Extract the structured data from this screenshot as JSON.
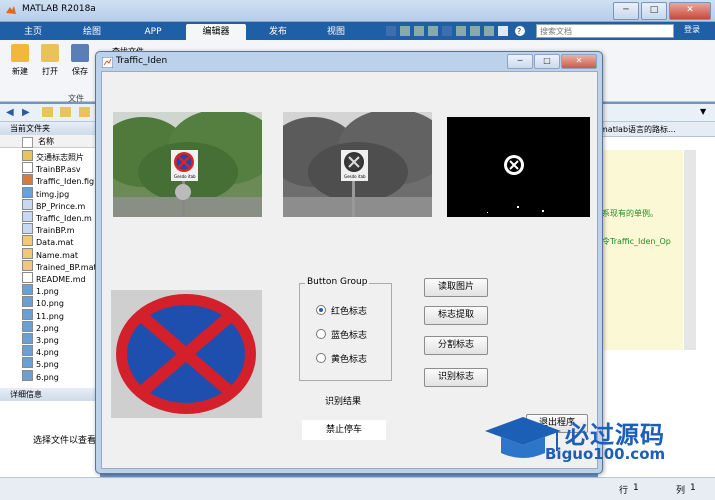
{
  "app": {
    "title": "MATLAB R2018a"
  },
  "tabs": [
    {
      "label": "主页"
    },
    {
      "label": "绘图"
    },
    {
      "label": "APP"
    },
    {
      "label": "编辑器"
    },
    {
      "label": "发布"
    },
    {
      "label": "视图"
    }
  ],
  "search": {
    "placeholder": "搜索文档",
    "login": "登录"
  },
  "ribbon": {
    "buttons": [
      {
        "label": "新建"
      },
      {
        "label": "打开"
      },
      {
        "label": "保存"
      }
    ],
    "group_label": "文件",
    "find_label": "查找文件"
  },
  "left_panel": {
    "header": "当前文件夹",
    "column": "名称",
    "files": [
      {
        "name": "交通标志照片",
        "icon": "folder-icon"
      },
      {
        "name": "TrainBP.asv",
        "icon": "file-icon"
      },
      {
        "name": "Traffic_Iden.fig",
        "icon": "fig-icon"
      },
      {
        "name": "timg.jpg",
        "icon": "image-icon"
      },
      {
        "name": "BP_Prince.m",
        "icon": "m-icon"
      },
      {
        "name": "Traffic_Iden.m",
        "icon": "m-icon"
      },
      {
        "name": "TrainBP.m",
        "icon": "m-icon"
      },
      {
        "name": "Data.mat",
        "icon": "mat-icon"
      },
      {
        "name": "Name.mat",
        "icon": "mat-icon"
      },
      {
        "name": "Trained_BP.mat",
        "icon": "mat-icon"
      },
      {
        "name": "README.md",
        "icon": "file-icon"
      },
      {
        "name": "1.png",
        "icon": "image-icon"
      },
      {
        "name": "10.png",
        "icon": "image-icon"
      },
      {
        "name": "11.png",
        "icon": "image-icon"
      },
      {
        "name": "2.png",
        "icon": "image-icon"
      },
      {
        "name": "3.png",
        "icon": "image-icon"
      },
      {
        "name": "4.png",
        "icon": "image-icon"
      },
      {
        "name": "5.png",
        "icon": "image-icon"
      },
      {
        "name": "6.png",
        "icon": "image-icon"
      }
    ],
    "details_header": "详细信息",
    "details_text": "选择文件以查看"
  },
  "editor": {
    "tab_text": "matlab语言的路标...",
    "line1": "系现有的单例。",
    "line2": "令Traffic_Iden_Op"
  },
  "status": {
    "row_label": "行",
    "row": "1",
    "col_label": "列",
    "col": "1"
  },
  "figure": {
    "title": "Traffic_Iden",
    "button_group_title": "Button Group",
    "radios": [
      {
        "label": "红色标志",
        "selected": true
      },
      {
        "label": "蓝色标志",
        "selected": false
      },
      {
        "label": "黄色标志",
        "selected": false
      }
    ],
    "buttons": [
      {
        "label": "读取图片"
      },
      {
        "label": "标志提取"
      },
      {
        "label": "分割标志"
      },
      {
        "label": "识别标志"
      },
      {
        "label": "退出程序"
      }
    ],
    "result_label": "识别结果",
    "result_value": "禁止停车",
    "sign_text": "Gesdo itab"
  },
  "watermark": {
    "text": "必过源码",
    "url": "Biguo100.com"
  }
}
